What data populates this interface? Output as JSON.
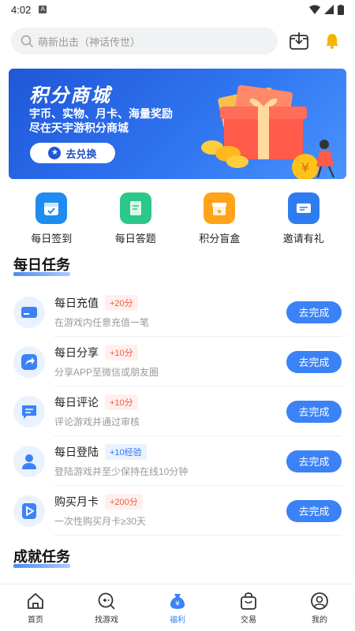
{
  "status": {
    "time": "4:02"
  },
  "search": {
    "placeholder": "萌新出击（神话传世）"
  },
  "banner": {
    "title": "积分商城",
    "subtitle_line1": "宇币、实物、月卡、海量奖励",
    "subtitle_line2": "尽在天宇游积分商城",
    "button": "去兑换"
  },
  "quick": [
    {
      "label": "每日签到",
      "icon": "calendar-check-icon",
      "color": "#1e8cf0"
    },
    {
      "label": "每日答题",
      "icon": "quiz-card-icon",
      "color": "#2cc78a"
    },
    {
      "label": "积分盲盒",
      "icon": "blind-box-icon",
      "color": "#ffa31a"
    },
    {
      "label": "邀请有礼",
      "icon": "invite-ticket-icon",
      "color": "#2f7cf0"
    }
  ],
  "daily": {
    "title": "每日任务",
    "tasks": [
      {
        "name": "每日充值",
        "badge": "+20分",
        "desc": "在游戏内任意充值一笔",
        "button": "去完成"
      },
      {
        "name": "每日分享",
        "badge": "+10分",
        "desc": "分享APP至微信或朋友圈",
        "button": "去完成"
      },
      {
        "name": "每日评论",
        "badge": "+10分",
        "desc": "评论游戏并通过审核",
        "button": "去完成"
      },
      {
        "name": "每日登陆",
        "badge": "+10经验",
        "desc": "登陆游戏并至少保持在线10分钟",
        "button": "去完成"
      },
      {
        "name": "购买月卡",
        "badge": "+200分",
        "desc": "一次性购买月卡≥30天",
        "button": "去完成"
      }
    ]
  },
  "achievement": {
    "title": "成就任务",
    "partial_name": "成就任务"
  },
  "nav": [
    {
      "label": "首页"
    },
    {
      "label": "找游戏"
    },
    {
      "label": "福利"
    },
    {
      "label": "交易"
    },
    {
      "label": "我的"
    }
  ],
  "colors": {
    "primary": "#3b82f6",
    "badge_red": "#f05a3c"
  }
}
